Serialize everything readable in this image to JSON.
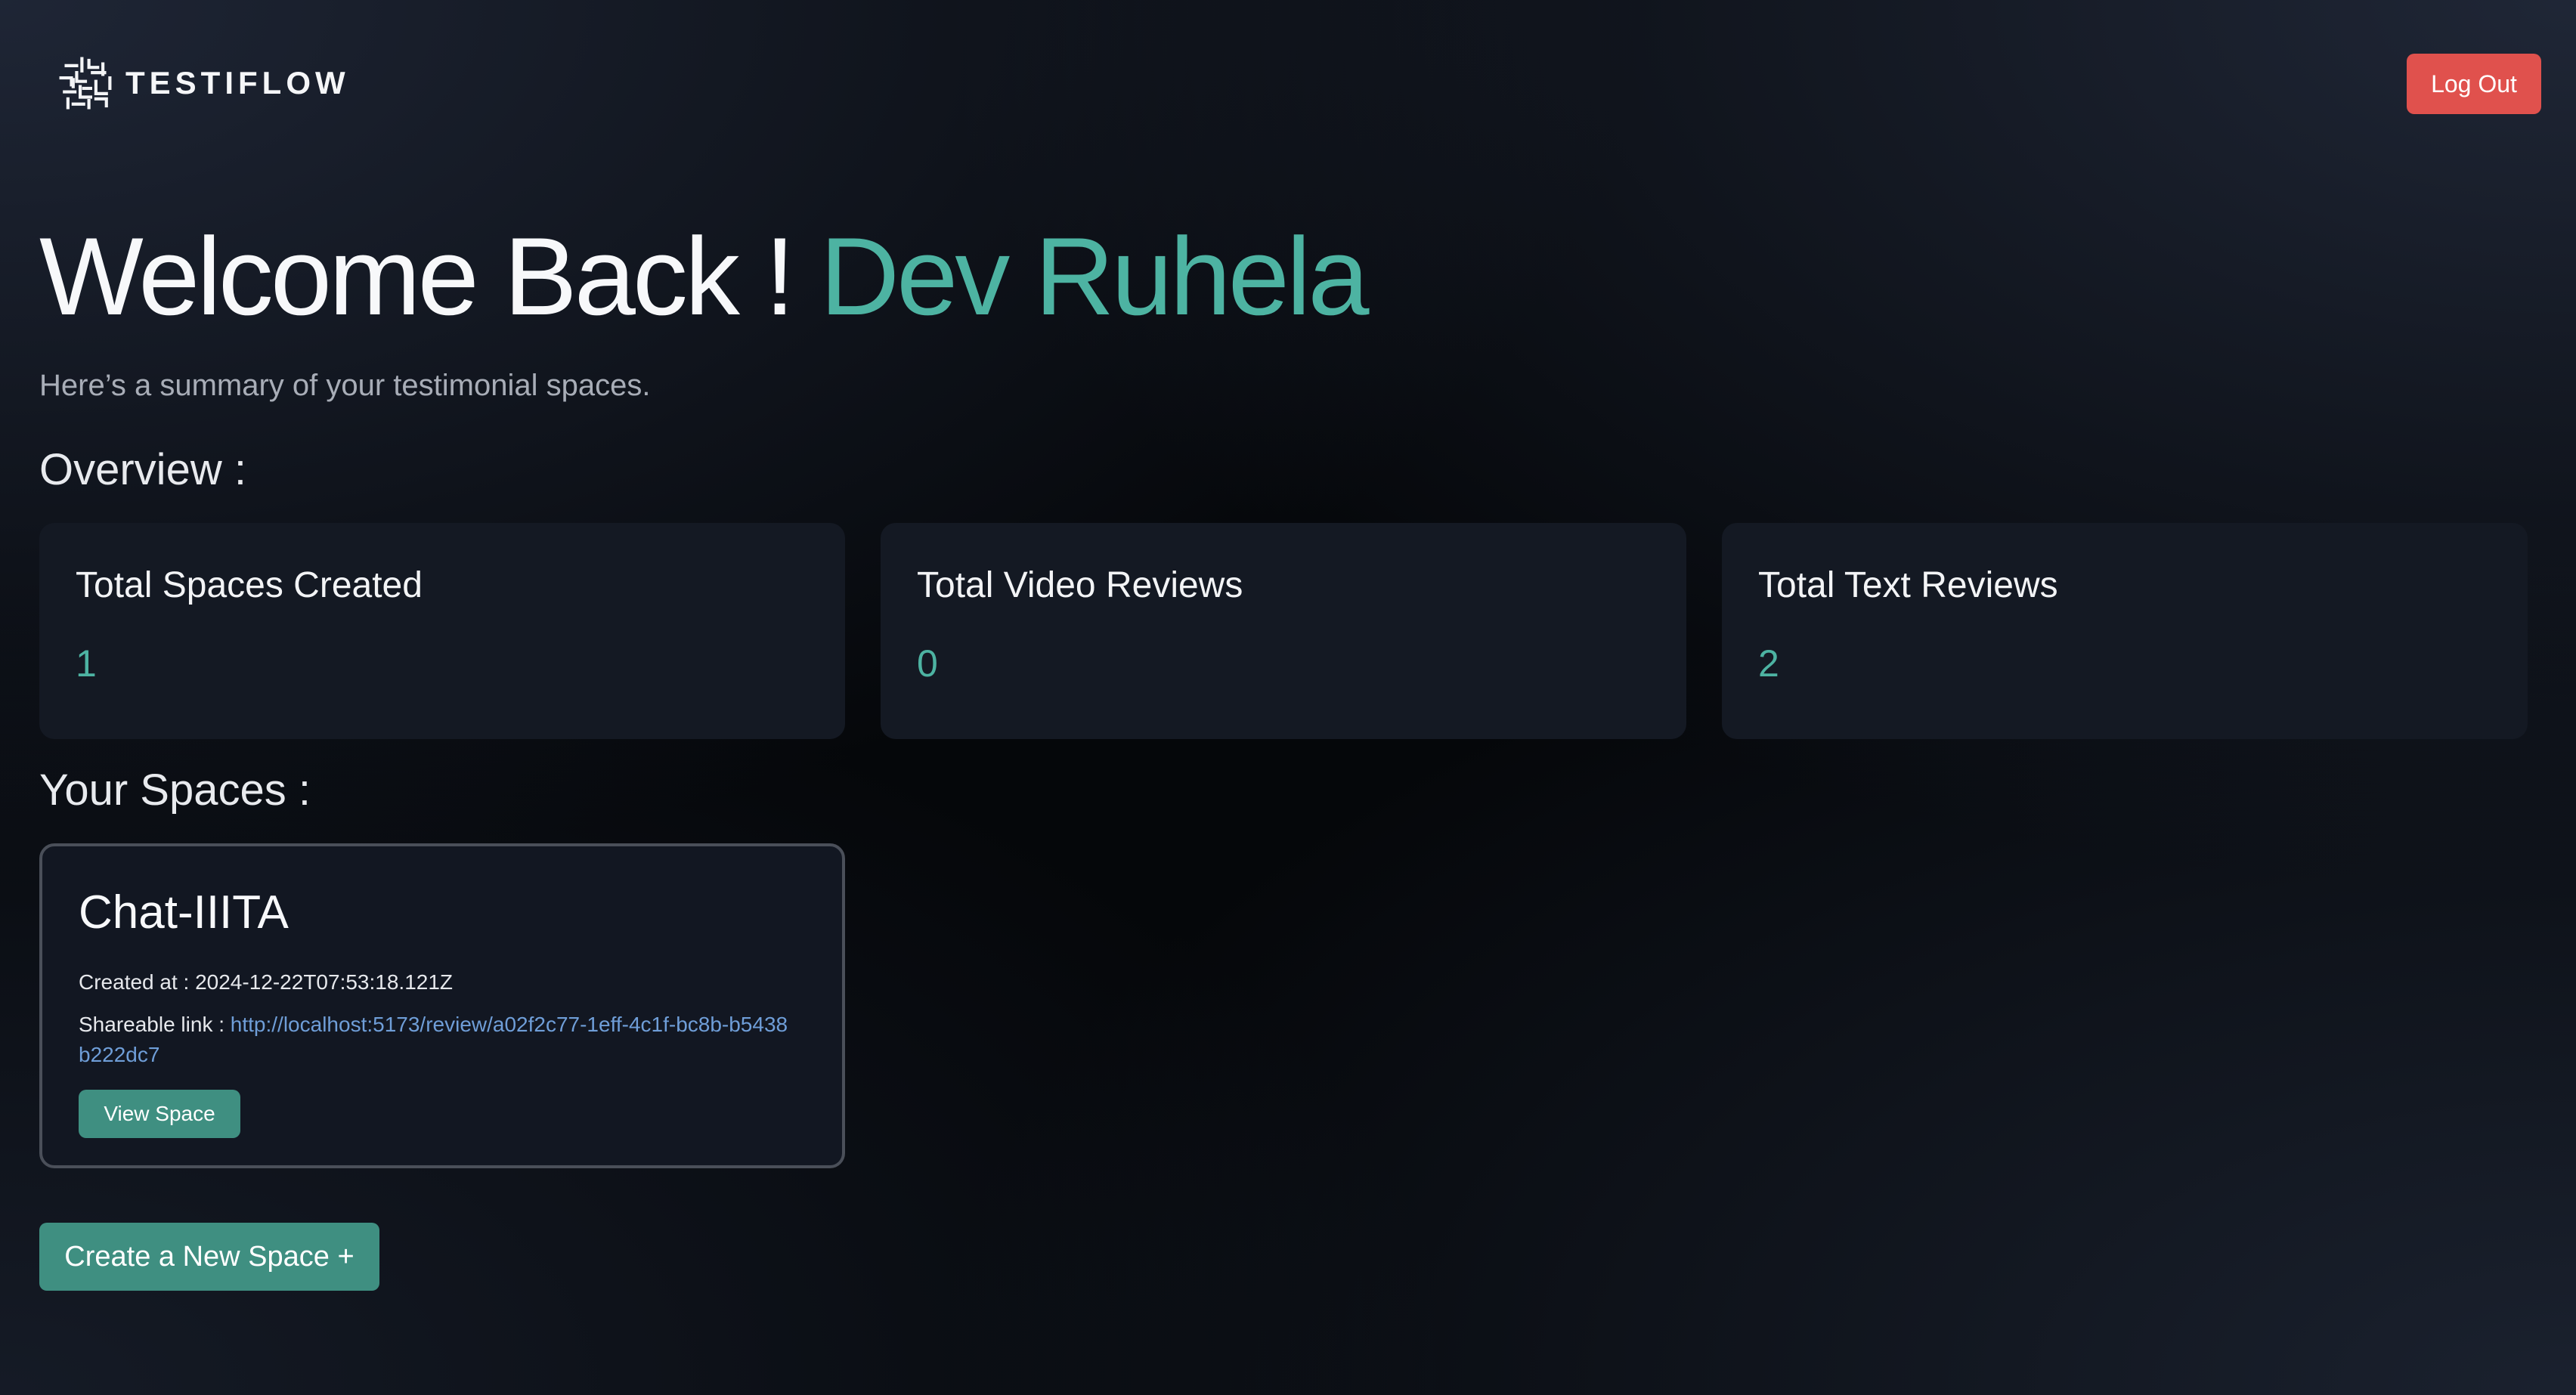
{
  "header": {
    "brand": "TESTIFLOW",
    "logout_label": "Log Out"
  },
  "welcome": {
    "greeting": "Welcome Back !",
    "user_name": "Dev Ruhela",
    "subtitle": "Here’s a summary of your testimonial spaces."
  },
  "overview": {
    "title": "Overview :",
    "stats": [
      {
        "label": "Total Spaces Created",
        "value": "1"
      },
      {
        "label": "Total Video Reviews",
        "value": "0"
      },
      {
        "label": "Total Text Reviews",
        "value": "2"
      }
    ]
  },
  "spaces": {
    "title": "Your Spaces :",
    "items": [
      {
        "name": "Chat-IIITA",
        "created_label": "Created at :",
        "created_at": "2024-12-22T07:53:18.121Z",
        "link_label": "Shareable link :",
        "link": "http://localhost:5173/review/a02f2c77-1eff-4c1f-bc8b-b5438b222dc7",
        "view_label": "View Space"
      }
    ]
  },
  "create_button_label": "Create a New Space +",
  "colors": {
    "accent": "#4db3a2",
    "primary_button": "#3f8f81",
    "danger_button": "#e0514d",
    "card_background": "#141923",
    "link": "#6f9ed8"
  },
  "icons": {
    "logo": "maze-logo-icon"
  }
}
